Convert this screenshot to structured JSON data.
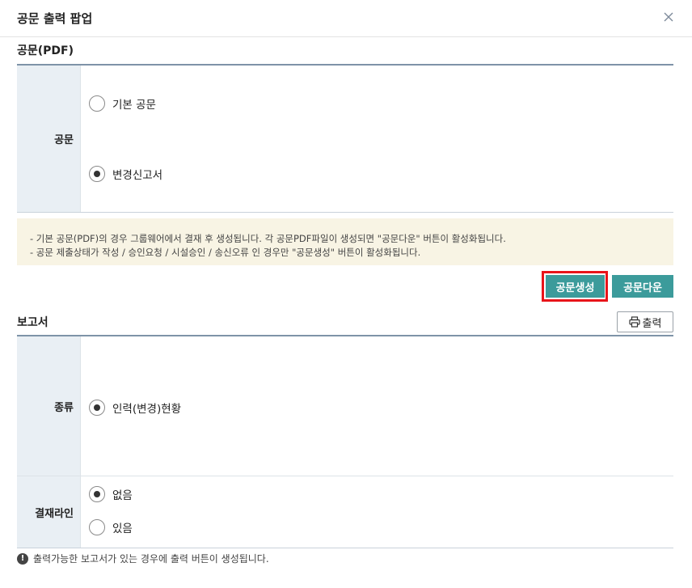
{
  "header": {
    "title": "공문 출력 팝업",
    "close_icon": "close-icon"
  },
  "official_doc": {
    "section_title": "공문(PDF)",
    "row_label": "공문",
    "options": [
      {
        "label": "기본 공문",
        "checked": false
      },
      {
        "label": "변경신고서",
        "checked": true
      }
    ],
    "notice_lines": [
      "- 기본 공문(PDF)의 경우 그룹웨어에서 결재 후 생성됩니다. 각 공문PDF파일이 생성되면 \"공문다운\" 버튼이 활성화됩니다.",
      "- 공문 제출상태가 작성 / 승인요청 / 시설승인 / 송신오류 인 경우만 \"공문생성\" 버튼이 활성화됩니다."
    ],
    "create_button": "공문생성",
    "download_button": "공문다운"
  },
  "report": {
    "section_title": "보고서",
    "print_button": "출력",
    "print_icon": "printer-icon",
    "type_label": "종류",
    "type_options": [
      {
        "label": "인력(변경)현황",
        "checked": true
      }
    ],
    "approval_label": "결재라인",
    "approval_options": [
      {
        "label": "없음",
        "checked": true
      },
      {
        "label": "있음",
        "checked": false
      }
    ],
    "footnote": "출력가능한 보고서가 있는 경우에 출력 버튼이 생성됩니다.",
    "footnote_icon": "info-icon"
  },
  "colors": {
    "teal_button": "#3c9b9b",
    "highlight_border": "#e8141a",
    "header_cell_bg": "#e9eff4",
    "notice_bg": "#f8f4e4",
    "table_top_border": "#7e93a8"
  }
}
